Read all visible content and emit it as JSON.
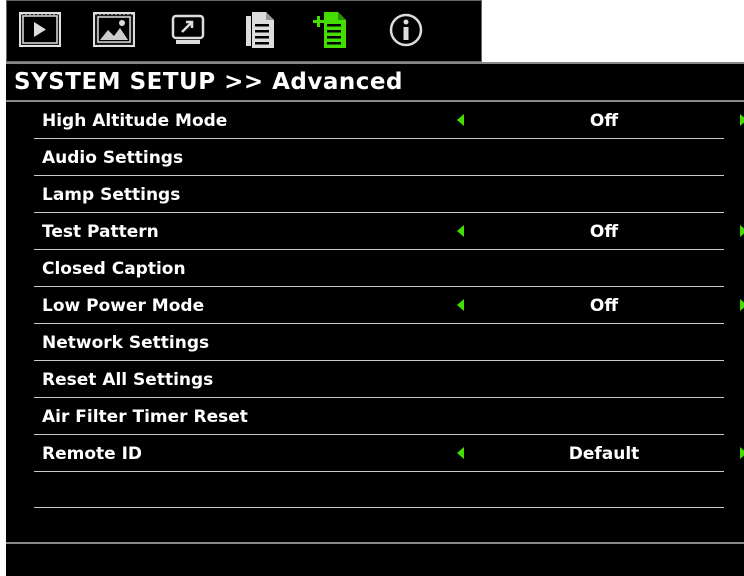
{
  "tabs": [
    {
      "icon": "display-icon",
      "active": false
    },
    {
      "icon": "image-icon",
      "active": false
    },
    {
      "icon": "screen-icon",
      "active": false
    },
    {
      "icon": "setup-basic-icon",
      "active": false
    },
    {
      "icon": "setup-advanced-icon",
      "active": true
    },
    {
      "icon": "info-icon",
      "active": false
    }
  ],
  "title": "SYSTEM SETUP >> Advanced",
  "menu": {
    "items": [
      {
        "label": "High Altitude Mode",
        "value": "Off"
      },
      {
        "label": "Audio Settings",
        "value": ""
      },
      {
        "label": "Lamp Settings",
        "value": ""
      },
      {
        "label": "Test Pattern",
        "value": "Off"
      },
      {
        "label": "Closed Caption",
        "value": ""
      },
      {
        "label": "Low Power Mode",
        "value": "Off"
      },
      {
        "label": "Network Settings",
        "value": ""
      },
      {
        "label": "Reset All Settings",
        "value": ""
      },
      {
        "label": "Air Filter Timer Reset",
        "value": ""
      },
      {
        "label": "Remote ID",
        "value": "Default"
      }
    ]
  },
  "colors": {
    "background": "#000000",
    "text": "#ffffff",
    "arrow": "#44dd00",
    "active_tab": "#44dd00",
    "separator": "#c8c8c8"
  }
}
